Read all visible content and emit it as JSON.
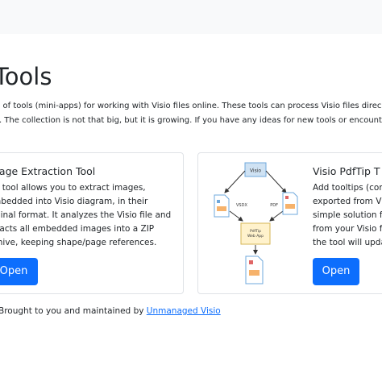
{
  "page": {
    "title": "Tools",
    "intro": {
      "line1": "n of tools (mini-apps) for working with Visio files online. These tools can process Visio files direc",
      "line2_bold": "r",
      "line2_rest": ". The collection is not that big, but it is growing. If you have any ideas for new tools or encount"
    }
  },
  "cards": [
    {
      "title": "nage Extraction Tool",
      "description_lines": [
        "is tool allows you to extract images,",
        "mbedded into Visio diagram, in their",
        "iginal format. It analyzes the Visio file and",
        "tracts all embedded images into a ZIP",
        "chive, keeping shape/page references."
      ],
      "button_label": "Open"
    },
    {
      "title": "Visio PdfTip T",
      "description_lines": [
        "Add tooltips (com",
        "exported from Vis",
        "simple solution fo",
        "from your Visio fi",
        "the tool will upda"
      ],
      "button_label": "Open",
      "diagram": {
        "top_box_label": "Visio",
        "left_doc_label": "VSDX",
        "right_doc_label": "PDF",
        "center_box_label_1": "PdfTip",
        "center_box_label_2": "Web App"
      }
    }
  ],
  "footer": {
    "prefix": "Brought to you and maintained by ",
    "link_text": "Unmanaged Visio"
  },
  "colors": {
    "accent": "#0d6efd",
    "topbar": "#f8f9fa",
    "card_border": "#dfe2e6"
  }
}
